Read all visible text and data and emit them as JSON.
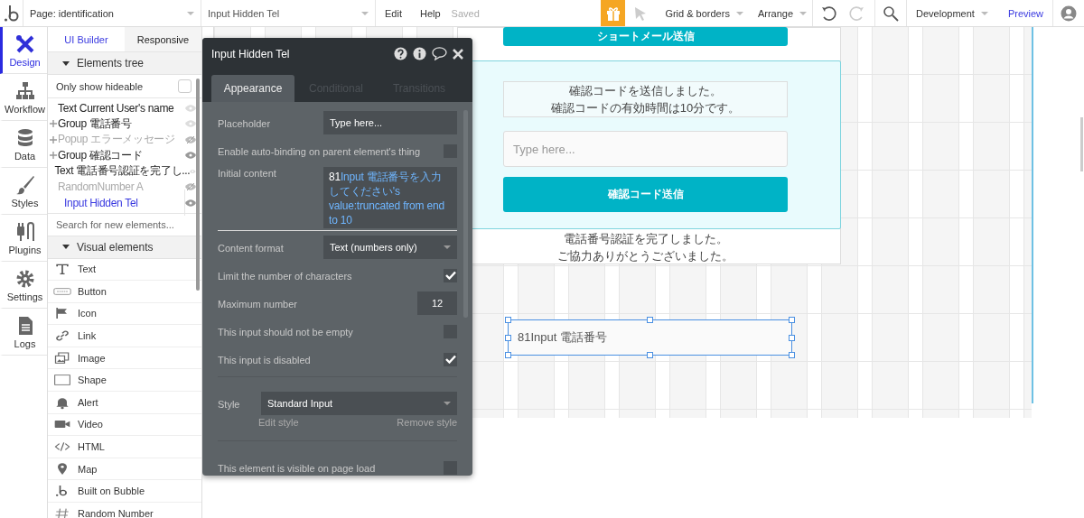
{
  "top_bar": {
    "page_selector": "Page: identification",
    "element_selector": "Input Hidden Tel",
    "menu": [
      {
        "label": "Edit"
      },
      {
        "label": "Help"
      }
    ],
    "save_status": "Saved",
    "view_menus": [
      {
        "label": "Grid & borders"
      },
      {
        "label": "Arrange"
      }
    ],
    "environment": "Development",
    "preview": "Preview"
  },
  "rail": [
    {
      "label": "Design",
      "selected": true
    },
    {
      "label": "Workflow",
      "selected": false
    },
    {
      "label": "Data",
      "selected": false
    },
    {
      "label": "Styles",
      "selected": false
    },
    {
      "label": "Plugins",
      "selected": false
    },
    {
      "label": "Settings",
      "selected": false
    },
    {
      "label": "Logs",
      "selected": false
    }
  ],
  "panel_tabs": [
    {
      "label": "UI Builder",
      "selected": true
    },
    {
      "label": "Responsive",
      "selected": false
    }
  ],
  "elements_tree": {
    "heading": "Elements tree",
    "filter": {
      "label": "Only show hideable",
      "checked": false
    },
    "items": [
      {
        "label": "Text Current User's name",
        "expandable": false,
        "dimmed": false,
        "selected": false,
        "visible": true,
        "eye_active": false
      },
      {
        "label": "Group 電話番号",
        "expandable": true,
        "dimmed": false,
        "selected": false,
        "visible": true,
        "eye_active": false
      },
      {
        "label": "Popup エラーメッセージ",
        "expandable": true,
        "dimmed": true,
        "selected": false,
        "visible": false,
        "eye_active": false
      },
      {
        "label": "Group 確認コード",
        "expandable": true,
        "dimmed": false,
        "selected": false,
        "visible": true,
        "eye_active": true
      },
      {
        "label": "Text 電話番号認証を完了し...",
        "expandable": false,
        "dimmed": false,
        "selected": false,
        "visible": true,
        "eye_active": false
      },
      {
        "label": "RandomNumber A",
        "expandable": false,
        "dimmed": true,
        "selected": false,
        "visible": false,
        "eye_active": false
      },
      {
        "label": "Input Hidden Tel",
        "expandable": false,
        "dimmed": false,
        "selected": true,
        "visible": true,
        "eye_active": true
      }
    ]
  },
  "element_search": {
    "placeholder": "Search for new elements..."
  },
  "visual_elements": {
    "heading": "Visual elements",
    "items": [
      {
        "label": "Text"
      },
      {
        "label": "Button"
      },
      {
        "label": "Icon"
      },
      {
        "label": "Link"
      },
      {
        "label": "Image"
      },
      {
        "label": "Shape"
      },
      {
        "label": "Alert"
      },
      {
        "label": "Video"
      },
      {
        "label": "HTML"
      },
      {
        "label": "Map"
      },
      {
        "label": "Built on Bubble"
      },
      {
        "label": "Random Number"
      }
    ]
  },
  "property_editor": {
    "title": "Input Hidden Tel",
    "tabs": [
      {
        "label": "Appearance",
        "selected": true
      },
      {
        "label": "Conditional",
        "selected": false
      },
      {
        "label": "Transitions",
        "selected": false
      }
    ],
    "rows": [
      {
        "kind": "field",
        "label": "Placeholder",
        "value": "Type here..."
      },
      {
        "kind": "checkbox",
        "label": "Enable auto-binding on parent element's thing",
        "checked": false
      },
      {
        "kind": "expression",
        "label": "Initial content",
        "value": "81",
        "expression": "Input 電話番号を入力してください's value:truncated from end to 10"
      },
      {
        "kind": "dropdown",
        "label": "Content format",
        "value": "Text (numbers only)"
      },
      {
        "kind": "checkbox",
        "label": "Limit the number of characters",
        "checked": true
      },
      {
        "kind": "number",
        "label": "Maximum number",
        "value": "12"
      },
      {
        "kind": "checkbox",
        "label": "This input should not be empty",
        "checked": false
      },
      {
        "kind": "checkbox",
        "label": "This input is disabled",
        "checked": true
      },
      {
        "kind": "style",
        "label": "Style",
        "value": "Standard Input",
        "edit": "Edit style",
        "remove": "Remove style"
      },
      {
        "kind": "checkbox",
        "label": "This element is visible on page load",
        "checked": false
      }
    ]
  },
  "canvas": {
    "sms_button": "ショートメール送信",
    "sent_message": [
      "確認コードを送信しました。",
      "確認コードの有効時間は10分です。"
    ],
    "code_input": {
      "placeholder": "Type here..."
    },
    "confirm_button": "確認コード送信",
    "completion_message": [
      "電話番号認証を完了しました。",
      "ご協力ありがとうございました。"
    ],
    "selected_input": {
      "value": "81Input 電話番号"
    }
  }
}
